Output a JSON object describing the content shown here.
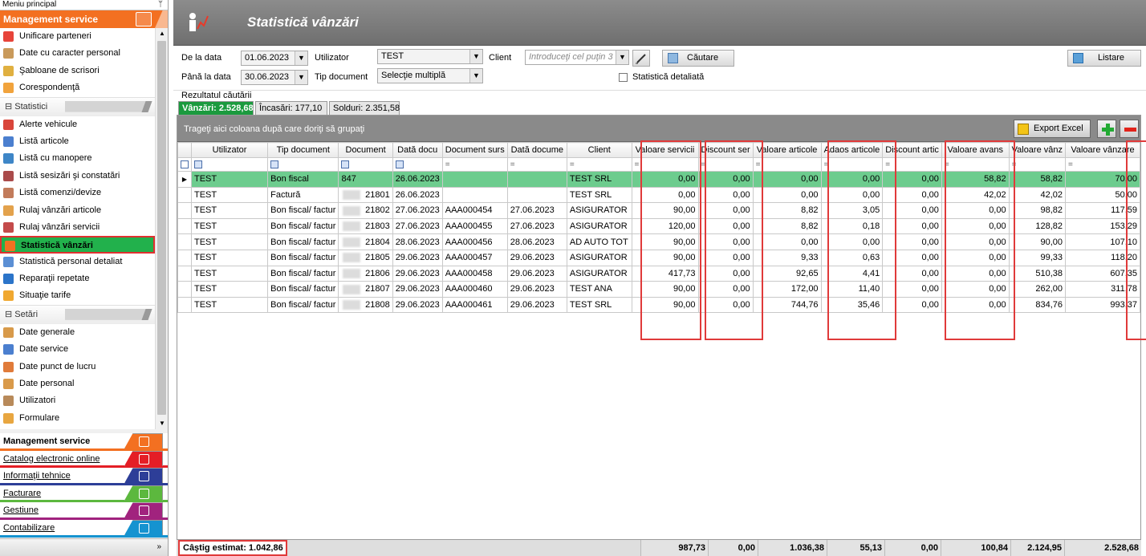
{
  "sidebar": {
    "title": "Meniu principal",
    "pin": "ᛘ",
    "module_title": "Management service",
    "top_items": [
      {
        "label": "Unificare parteneri",
        "color": "#e7443a"
      },
      {
        "label": "Date cu caracter personal",
        "color": "#c99a5b"
      },
      {
        "label": "Şabloane de scrisori",
        "color": "#e0b040"
      },
      {
        "label": "Corespondenţă",
        "color": "#f1a33c"
      }
    ],
    "group_statistici": "Statistici",
    "stat_items": [
      {
        "label": "Alerte vehicule",
        "color": "#d9453a"
      },
      {
        "label": "Listă articole",
        "color": "#4b7fcf"
      },
      {
        "label": "Listă cu manopere",
        "color": "#3e86c7"
      },
      {
        "label": "Listă sesizări şi constatări",
        "color": "#aa4b4b"
      },
      {
        "label": "Listă comenzi/devize",
        "color": "#c27b5b"
      },
      {
        "label": "Rulaj vânzări articole",
        "color": "#e3a24c"
      },
      {
        "label": "Rulaj vânzări servicii",
        "color": "#c44b4b"
      },
      {
        "label": "Statistică vânzări",
        "color": "#f37021",
        "active": true
      },
      {
        "label": "Statistică personal detaliat",
        "color": "#5b8fd4"
      },
      {
        "label": "Reparaţii repetate",
        "color": "#2b74c9"
      },
      {
        "label": "Situaţie tarife",
        "color": "#f0a830"
      }
    ],
    "group_setari": "Setări",
    "set_items": [
      {
        "label": "Date generale",
        "color": "#d89a4a"
      },
      {
        "label": "Date service",
        "color": "#4b7fcf"
      },
      {
        "label": "Date punct de lucru",
        "color": "#e07b3a"
      },
      {
        "label": "Date personal",
        "color": "#d99a4a"
      },
      {
        "label": "Utilizatori",
        "color": "#b88a5a"
      },
      {
        "label": "Formulare",
        "color": "#e8a640"
      }
    ],
    "modules": [
      {
        "label": "Management service",
        "color": "#f37021"
      },
      {
        "label": "Catalog electronic online",
        "color": "#e41e26"
      },
      {
        "label": "Informaţii tehnice",
        "color": "#2d3e98"
      },
      {
        "label": "Facturare",
        "color": "#5cb83e"
      },
      {
        "label": "Gestiune",
        "color": "#a1237e"
      },
      {
        "label": "Contabilizare",
        "color": "#1593d0"
      }
    ],
    "bottom_chevron": "»"
  },
  "header": {
    "title": "Statistică vânzări"
  },
  "filters": {
    "de_la_data_label": "De la data",
    "de_la_data": "01.06.2023",
    "pana_la_data_label": "Până la data",
    "pana_la_data": "30.06.2023",
    "utilizator_label": "Utilizator",
    "utilizator": "TEST",
    "tip_document_label": "Tip document",
    "tip_document": "Selecţie multiplă",
    "client_label": "Client",
    "client_placeholder": "Introduceţi cel puţin 3 c",
    "cautare": "Căutare",
    "listare": "Listare",
    "statistica_detaliata": "Statistică detaliată"
  },
  "results": {
    "label": "Rezultatul căutării",
    "tabs": [
      "Vânzări: 2.528,68",
      "Încasări: 177,10",
      "Solduri: 2.351,58"
    ],
    "group_hint": "Trageţi aici coloana după care doriţi să grupaţi",
    "export_excel": "Export Excel"
  },
  "table": {
    "columns": [
      "Utilizator",
      "Tip document",
      "Document",
      "Dată docu",
      "Document surs",
      "Dată docume",
      "Client",
      "Valoare servicii",
      "Discount ser",
      "Valoare articole",
      "Adaos articole",
      "Discount artic",
      "Valoare avans",
      "Valoare vânz",
      "Valoare vânzare"
    ],
    "rows": [
      [
        "TEST",
        "Bon fiscal",
        "847",
        "26.06.2023",
        "",
        "",
        "TEST SRL",
        "0,00",
        "0,00",
        "0,00",
        "0,00",
        "0,00",
        "58,82",
        "58,82",
        "70,00"
      ],
      [
        "TEST",
        "Factură",
        "21801",
        "26.06.2023",
        "",
        "",
        "TEST SRL",
        "0,00",
        "0,00",
        "0,00",
        "0,00",
        "0,00",
        "42,02",
        "42,02",
        "50,00"
      ],
      [
        "TEST",
        "Bon fiscal/ factur",
        "21802",
        "27.06.2023",
        "AAA000454",
        "27.06.2023",
        "ASIGURATOR",
        "90,00",
        "0,00",
        "8,82",
        "3,05",
        "0,00",
        "0,00",
        "98,82",
        "117,59"
      ],
      [
        "TEST",
        "Bon fiscal/ factur",
        "21803",
        "27.06.2023",
        "AAA000455",
        "27.06.2023",
        "ASIGURATOR",
        "120,00",
        "0,00",
        "8,82",
        "0,18",
        "0,00",
        "0,00",
        "128,82",
        "153,29"
      ],
      [
        "TEST",
        "Bon fiscal/ factur",
        "21804",
        "28.06.2023",
        "AAA000456",
        "28.06.2023",
        "AD AUTO TOT",
        "90,00",
        "0,00",
        "0,00",
        "0,00",
        "0,00",
        "0,00",
        "90,00",
        "107,10"
      ],
      [
        "TEST",
        "Bon fiscal/ factur",
        "21805",
        "29.06.2023",
        "AAA000457",
        "29.06.2023",
        "ASIGURATOR",
        "90,00",
        "0,00",
        "9,33",
        "0,63",
        "0,00",
        "0,00",
        "99,33",
        "118,20"
      ],
      [
        "TEST",
        "Bon fiscal/ factur",
        "21806",
        "29.06.2023",
        "AAA000458",
        "29.06.2023",
        "ASIGURATOR",
        "417,73",
        "0,00",
        "92,65",
        "4,41",
        "0,00",
        "0,00",
        "510,38",
        "607,35"
      ],
      [
        "TEST",
        "Bon fiscal/ factur",
        "21807",
        "29.06.2023",
        "AAA000460",
        "29.06.2023",
        "TEST ANA",
        "90,00",
        "0,00",
        "172,00",
        "11,40",
        "0,00",
        "0,00",
        "262,00",
        "311,78"
      ],
      [
        "TEST",
        "Bon fiscal/ factur",
        "21808",
        "29.06.2023",
        "AAA000461",
        "29.06.2023",
        "TEST SRL",
        "90,00",
        "0,00",
        "744,76",
        "35,46",
        "0,00",
        "0,00",
        "834,76",
        "993,37"
      ]
    ]
  },
  "footer": {
    "castig": "Câştig estimat: 1.042,86",
    "totals": [
      "987,73",
      "0,00",
      "1.036,38",
      "55,13",
      "0,00",
      "100,84",
      "2.124,95",
      "2.528,68"
    ]
  },
  "colors": {
    "accent": "#f37021",
    "selected_row": "#6dcc8e",
    "active_tab": "#1b9a3e",
    "highlight": "#e03a3a"
  }
}
